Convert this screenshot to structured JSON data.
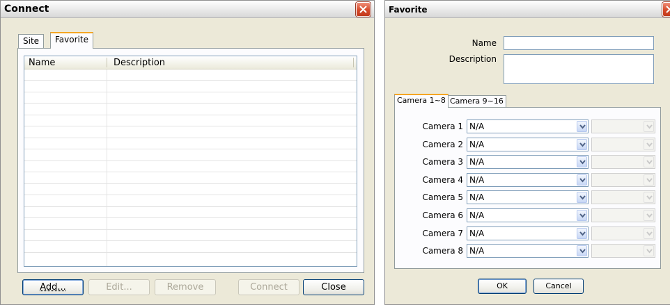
{
  "connect_dialog": {
    "title": "Connect",
    "tabs": [
      {
        "label": "Site"
      },
      {
        "label": "Favorite"
      }
    ],
    "columns": [
      {
        "label": "Name"
      },
      {
        "label": "Description"
      }
    ],
    "buttons": {
      "add": "Add...",
      "edit": "Edit...",
      "remove": "Remove",
      "connect": "Connect",
      "close": "Close"
    }
  },
  "favorite_dialog": {
    "title": "Favorite",
    "name_label": "Name",
    "name_value": "",
    "description_label": "Description",
    "description_value": "",
    "tabs": [
      {
        "label": "Camera 1~8"
      },
      {
        "label": "Camera 9~16"
      }
    ],
    "cameras": [
      {
        "label": "Camera 1",
        "value": "N/A"
      },
      {
        "label": "Camera 2",
        "value": "N/A"
      },
      {
        "label": "Camera 3",
        "value": "N/A"
      },
      {
        "label": "Camera 4",
        "value": "N/A"
      },
      {
        "label": "Camera 5",
        "value": "N/A"
      },
      {
        "label": "Camera 6",
        "value": "N/A"
      },
      {
        "label": "Camera 7",
        "value": "N/A"
      },
      {
        "label": "Camera 8",
        "value": "N/A"
      }
    ],
    "buttons": {
      "ok": "OK",
      "cancel": "Cancel"
    }
  },
  "colors": {
    "dialog_bg": "#ece9d8",
    "close_button": "#d54a2a",
    "active_tab_accent": "#f5a623"
  }
}
